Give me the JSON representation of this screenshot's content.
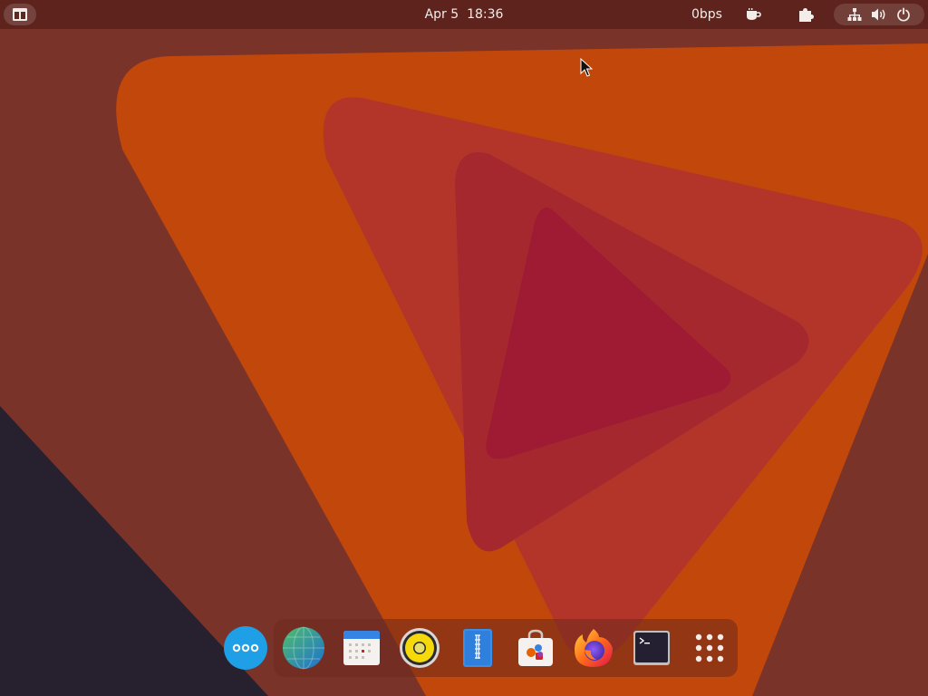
{
  "topbar": {
    "activities_icon": "window-layout-icon",
    "clock": {
      "date": "Apr 5",
      "time": "18:36"
    },
    "net_speed": "0bps",
    "extension_icons": [
      "coffee-cup-icon",
      "puzzle-icon"
    ],
    "system_icons": [
      "network-icon",
      "volume-icon",
      "power-icon"
    ]
  },
  "dock": {
    "items": [
      {
        "name": "more-apps",
        "icon": "ellipsis-icon"
      },
      {
        "name": "web-browser",
        "icon": "globe-icon"
      },
      {
        "name": "calendar",
        "icon": "calendar-icon"
      },
      {
        "name": "music-player",
        "icon": "speaker-icon"
      },
      {
        "name": "file-archiver",
        "icon": "archive-icon"
      },
      {
        "name": "software-center",
        "icon": "shopping-bag-icon"
      },
      {
        "name": "firefox",
        "icon": "firefox-icon"
      },
      {
        "name": "terminal",
        "icon": "terminal-icon"
      },
      {
        "name": "show-applications",
        "icon": "grid-icon"
      }
    ]
  },
  "colors": {
    "wallpaper_base": "#7a3328",
    "wallpaper_dark": "#27202f",
    "orange": "#c2470b",
    "red_mid": "#b3352a",
    "red_inner": "#a6282f",
    "red_core": "#9f1a33",
    "dock_blue": "#1e9fe6"
  }
}
